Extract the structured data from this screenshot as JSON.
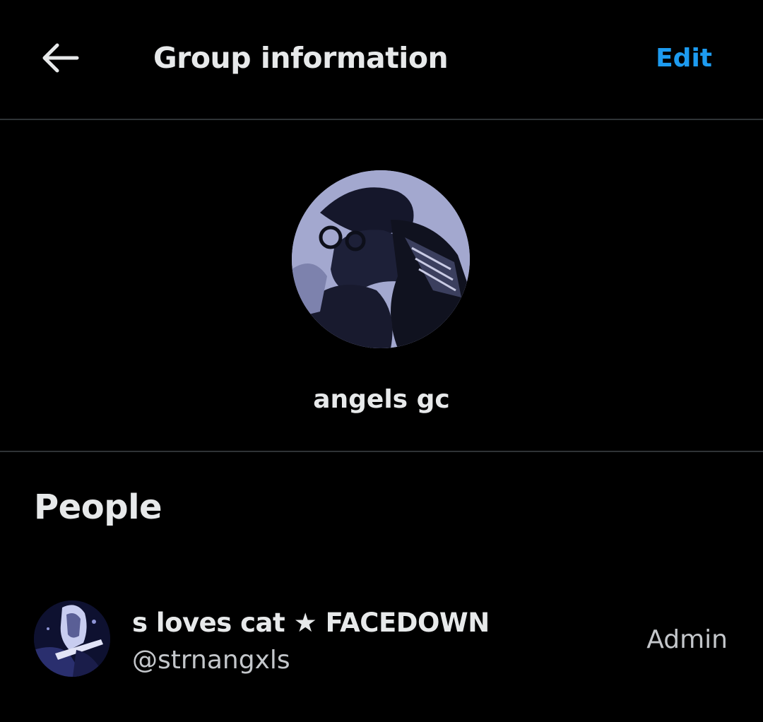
{
  "colors": {
    "background": "#000000",
    "accent": "#1d9bf0",
    "text_primary": "#e7e9ea",
    "text_secondary": "#c4c7cb",
    "divider": "#2f3336"
  },
  "header": {
    "back_icon": "arrow-left-icon",
    "title": "Group information",
    "edit_label": "Edit"
  },
  "group": {
    "avatar_icon": "group-photo",
    "name": "angels gc"
  },
  "people": {
    "section_title": "People",
    "members": [
      {
        "avatar_icon": "member-photo",
        "display_name": "s loves cat ★ FACEDOWN",
        "handle": "@strnangxls",
        "role": "Admin"
      }
    ]
  }
}
